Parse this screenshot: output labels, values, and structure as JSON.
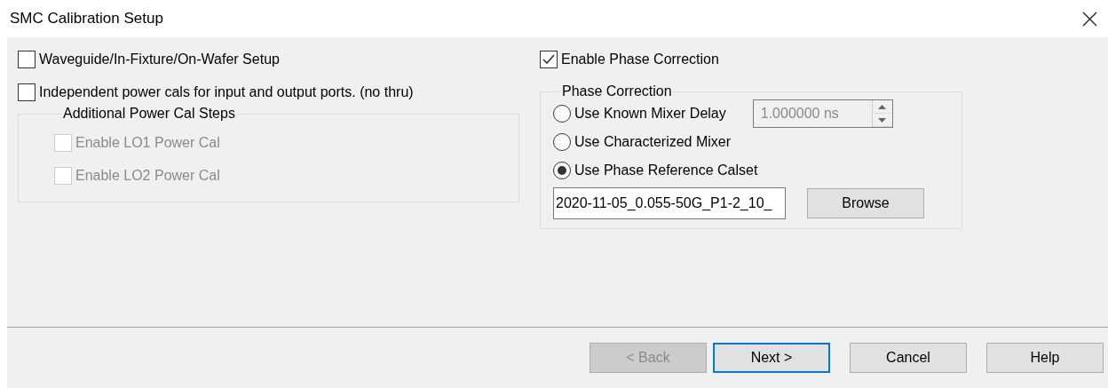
{
  "window": {
    "title": "SMC Calibration Setup"
  },
  "options": [
    {
      "label": "Waveguide/In-Fixture/On-Wafer Setup",
      "checked": false
    },
    {
      "label": "Independent power cals for input and output ports. (no thru)",
      "checked": false
    }
  ],
  "power_cal_group": {
    "title": "Additional Power Cal Steps",
    "checkboxes": [
      {
        "label": "Enable LO1 Power Cal",
        "checked": false,
        "disabled": true
      },
      {
        "label": "Enable LO2 Power Cal",
        "checked": false,
        "disabled": true
      }
    ]
  },
  "phase": {
    "enable": {
      "label": "Enable Phase Correction",
      "checked": true
    },
    "group": {
      "title": "Phase Correction",
      "radios": [
        {
          "label": "Use Known Mixer Delay",
          "selected": false
        },
        {
          "label": "Use Characterized Mixer",
          "selected": false
        },
        {
          "label": "Use Phase Reference Calset",
          "selected": true
        }
      ],
      "delay": {
        "value": "1.000000 ns",
        "disabled": true
      },
      "calset": {
        "value": "2020-11-05_0.055-50G_P1-2_10_"
      },
      "browse": "Browse"
    }
  },
  "buttons": [
    {
      "label": "< Back",
      "disabled": true,
      "default": false
    },
    {
      "label": "Next >",
      "disabled": false,
      "default": true
    },
    {
      "label": "Cancel",
      "disabled": false,
      "default": false
    },
    {
      "label": "Help",
      "disabled": false,
      "default": false
    }
  ]
}
